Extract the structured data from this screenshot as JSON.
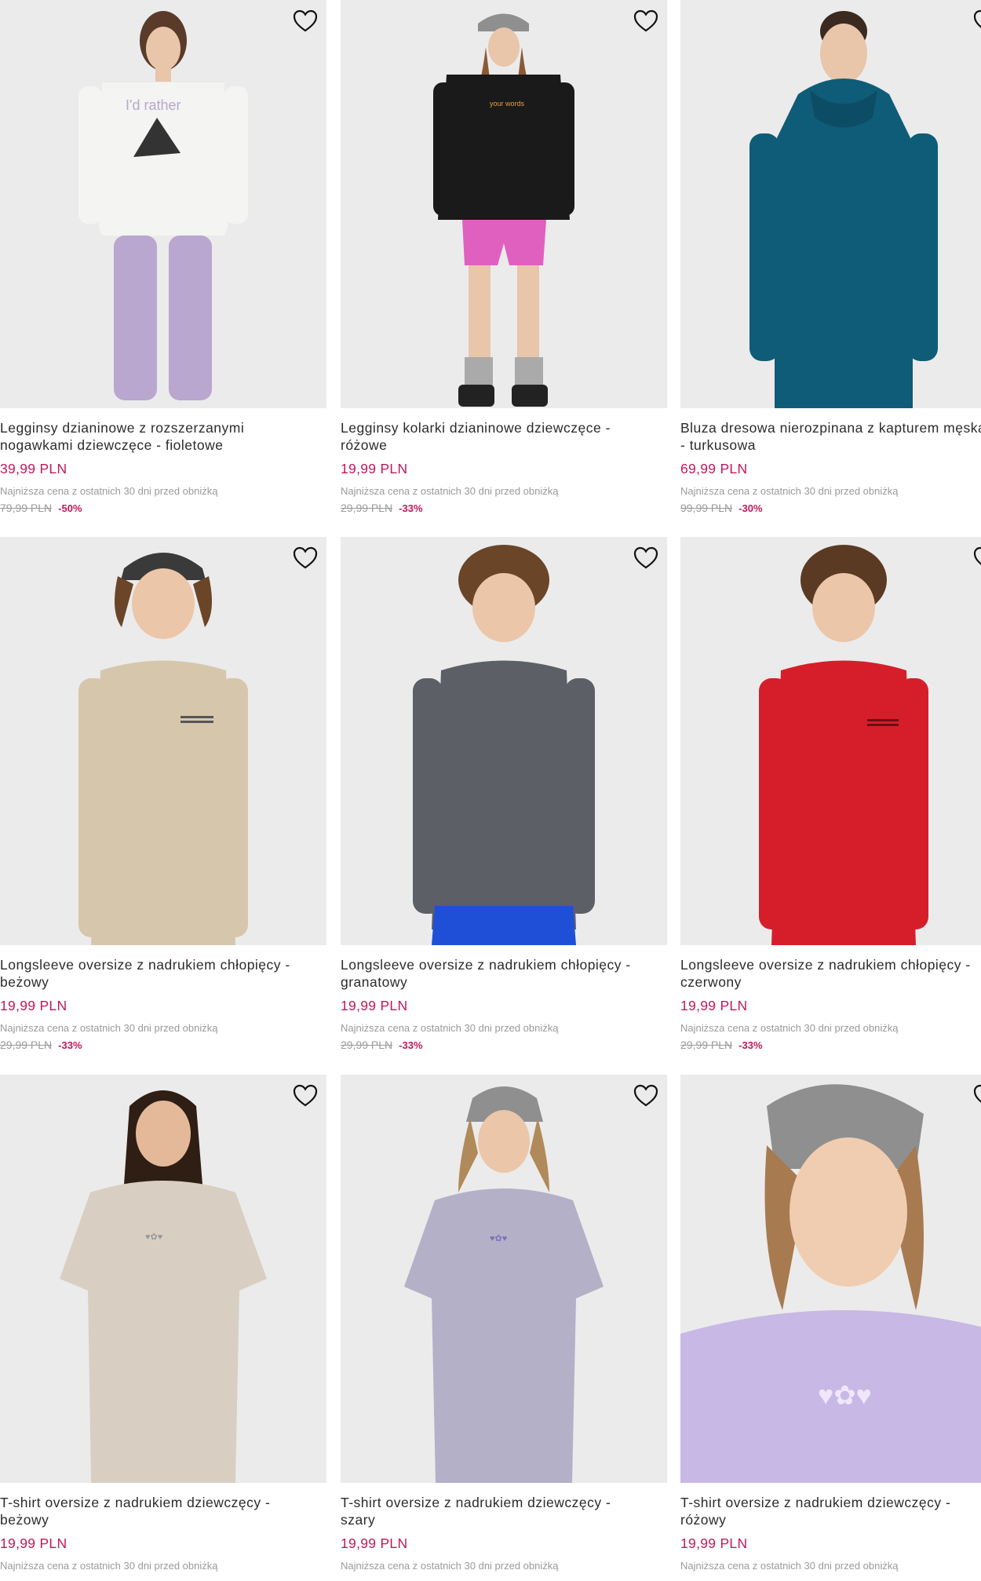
{
  "products": [
    {
      "name_1": "Legginsy dzianinowe z rozszerzanymi",
      "name_2": "nogawkami dziewczęce - fioletowe",
      "price": "39,99 PLN",
      "lowest_label": "Najniższa cena z ostatnich 30 dni przed obniżką",
      "old_price": "79,99 PLN",
      "discount": "-50%"
    },
    {
      "name_1": "Legginsy kolarki dzianinowe dziewczęce -",
      "name_2": "różowe",
      "price": "19,99 PLN",
      "lowest_label": "Najniższa cena z ostatnich 30 dni przed obniżką",
      "old_price": "29,99 PLN",
      "discount": "-33%"
    },
    {
      "name_1": "Bluza dresowa nierozpinana z kapturem męska",
      "name_2": "- turkusowa",
      "price": "69,99 PLN",
      "lowest_label": "Najniższa cena z ostatnich 30 dni przed obniżką",
      "old_price": "99,99 PLN",
      "discount": "-30%"
    },
    {
      "name_1": "Longsleeve oversize z nadrukiem chłopięcy -",
      "name_2": "beżowy",
      "price": "19,99 PLN",
      "lowest_label": "Najniższa cena z ostatnich 30 dni przed obniżką",
      "old_price": "29,99 PLN",
      "discount": "-33%"
    },
    {
      "name_1": "Longsleeve oversize z nadrukiem chłopięcy -",
      "name_2": "granatowy",
      "price": "19,99 PLN",
      "lowest_label": "Najniższa cena z ostatnich 30 dni przed obniżką",
      "old_price": "29,99 PLN",
      "discount": "-33%"
    },
    {
      "name_1": "Longsleeve oversize z nadrukiem chłopięcy -",
      "name_2": "czerwony",
      "price": "19,99 PLN",
      "lowest_label": "Najniższa cena z ostatnich 30 dni przed obniżką",
      "old_price": "29,99 PLN",
      "discount": "-33%"
    },
    {
      "name_1": "T-shirt oversize z nadrukiem dziewczęcy -",
      "name_2": "beżowy",
      "price": "19,99 PLN",
      "lowest_label": "Najniższa cena z ostatnich 30 dni przed obniżką",
      "old_price": "",
      "discount": ""
    },
    {
      "name_1": "T-shirt oversize z nadrukiem dziewczęcy -",
      "name_2": "szary",
      "price": "19,99 PLN",
      "lowest_label": "Najniższa cena z ostatnich 30 dni przed obniżką",
      "old_price": "",
      "discount": ""
    },
    {
      "name_1": "T-shirt oversize z nadrukiem dziewczęcy -",
      "name_2": "różowy",
      "price": "19,99 PLN",
      "lowest_label": "Najniższa cena z ostatnich 30 dni przed obniżką",
      "old_price": "",
      "discount": ""
    }
  ],
  "colors": {
    "price": "#c2185b",
    "muted": "#9a9a9a",
    "image_bg": "#e9e9e9",
    "top_1": "#f4f4f2",
    "bottom_1": "#b9a7cf",
    "top_2": "#1a1a1a",
    "bottom_2": "#e060c0",
    "top_3": "#0f5c78",
    "bottom_3": "#0f5c78",
    "top_4": "#d6c7ac",
    "top_5": "#5d5f66",
    "bottom_5": "#1f4fd6",
    "top_6": "#d61e2a",
    "top_7": "#d8cfc2",
    "top_8": "#b3b0c8",
    "top_9": "#c8b8e6"
  },
  "icons": {
    "wishlist": "heart-outline-icon"
  }
}
